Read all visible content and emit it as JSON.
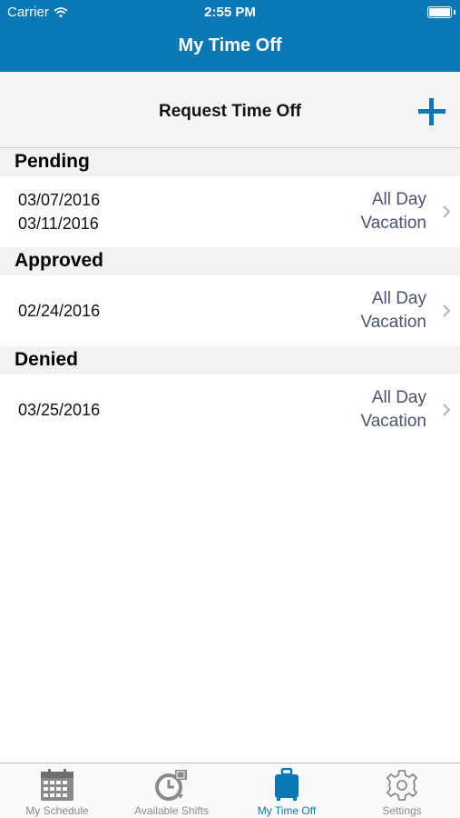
{
  "status_bar": {
    "carrier": "Carrier",
    "time": "2:55 PM"
  },
  "nav": {
    "title": "My Time Off"
  },
  "request": {
    "label": "Request Time Off"
  },
  "sections": [
    {
      "title": "Pending",
      "rows": [
        {
          "dates": [
            "03/07/2016",
            "03/11/2016"
          ],
          "duration": "All Day",
          "type": "Vacation"
        }
      ]
    },
    {
      "title": "Approved",
      "rows": [
        {
          "dates": [
            "02/24/2016"
          ],
          "duration": "All Day",
          "type": "Vacation"
        }
      ]
    },
    {
      "title": "Denied",
      "rows": [
        {
          "dates": [
            "03/25/2016"
          ],
          "duration": "All Day",
          "type": "Vacation"
        }
      ]
    }
  ],
  "tabs": [
    {
      "label": "My Schedule",
      "icon": "calendar-icon",
      "active": false
    },
    {
      "label": "Available Shifts",
      "icon": "clock-24-icon",
      "active": false
    },
    {
      "label": "My Time Off",
      "icon": "suitcase-icon",
      "active": true
    },
    {
      "label": "Settings",
      "icon": "gear-icon",
      "active": false
    }
  ],
  "colors": {
    "accent": "#0a78b4",
    "secondary_text": "#4a5472",
    "inactive_tab": "#8a8a8a"
  }
}
